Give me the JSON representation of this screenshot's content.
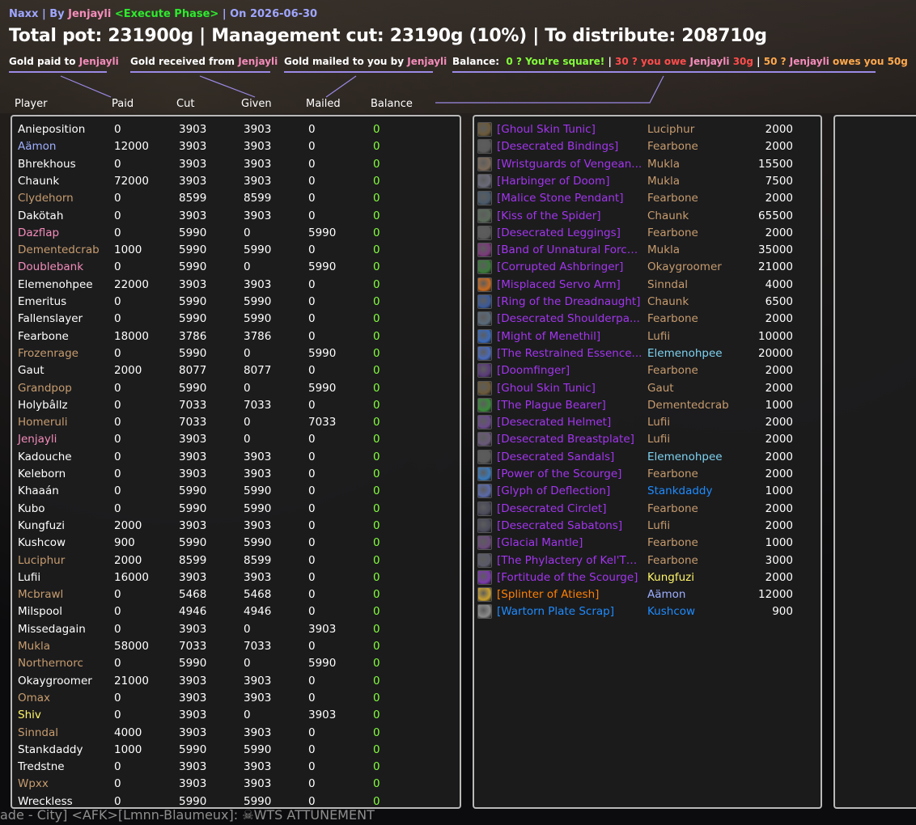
{
  "colors": {
    "title_text": "#ffffff",
    "accent": "#9b8ae6",
    "raid": "#9fa6ff",
    "player_jenjayli": "#f48cba",
    "phase": "#2eea2e",
    "balance_zero": "#83ff3c",
    "owe": "#ff4d4d",
    "owed": "#ffa94d",
    "epic": "#a335ee",
    "legendary": "#ff8000",
    "rare": "#1e8cff"
  },
  "header": {
    "raid": "Naxx",
    "by_sep": " | By ",
    "by_player": "Jenjayli",
    "phase": "<Execute Phase>",
    "date_sep": " | On ",
    "date": "2026-06-30"
  },
  "title": "Total pot: 231900g | Management cut: 23190g (10%) | To distribute: 208710g",
  "legend": {
    "paid_prefix": "Gold paid to ",
    "paid_player": "Jenjayli",
    "received_prefix": "Gold received from ",
    "received_player": "Jenjayli",
    "mailed_prefix": "Gold mailed to you by ",
    "mailed_player": "Jenjayli",
    "balance_label": "Balance:",
    "square_text": "0 ? You're square!",
    "sep": " | ",
    "owe_prefix": "30 ? you owe ",
    "owe_player": "Jenjayli",
    "owe_amount": " 30g",
    "owed_prefix": "50 ? ",
    "owed_player": "Jenjayli",
    "owed_suffix": " owes you 50g"
  },
  "columns": [
    "Player",
    "Paid",
    "Cut",
    "Given",
    "Mailed",
    "Balance"
  ],
  "players": [
    {
      "name": "Anieposition",
      "color": "#ffffff",
      "paid": "0",
      "cut": "3903",
      "given": "3903",
      "mailed": "0",
      "balance": "0"
    },
    {
      "name": "Aämon",
      "color": "#9fb0ff",
      "paid": "12000",
      "cut": "3903",
      "given": "3903",
      "mailed": "0",
      "balance": "0"
    },
    {
      "name": "Bhrekhous",
      "color": "#ffffff",
      "paid": "0",
      "cut": "3903",
      "given": "3903",
      "mailed": "0",
      "balance": "0"
    },
    {
      "name": "Chaunk",
      "color": "#ffffff",
      "paid": "72000",
      "cut": "3903",
      "given": "3903",
      "mailed": "0",
      "balance": "0"
    },
    {
      "name": "Clydehorn",
      "color": "#c79c6e",
      "paid": "0",
      "cut": "8599",
      "given": "8599",
      "mailed": "0",
      "balance": "0"
    },
    {
      "name": "Dakötah",
      "color": "#ffffff",
      "paid": "0",
      "cut": "3903",
      "given": "3903",
      "mailed": "0",
      "balance": "0"
    },
    {
      "name": "Dazflap",
      "color": "#f48cba",
      "paid": "0",
      "cut": "5990",
      "given": "0",
      "mailed": "5990",
      "balance": "0"
    },
    {
      "name": "Dementedcrab",
      "color": "#c79c6e",
      "paid": "1000",
      "cut": "5990",
      "given": "5990",
      "mailed": "0",
      "balance": "0"
    },
    {
      "name": "Doublebank",
      "color": "#f48cba",
      "paid": "0",
      "cut": "5990",
      "given": "0",
      "mailed": "5990",
      "balance": "0"
    },
    {
      "name": "Elemenohpee",
      "color": "#ffffff",
      "paid": "22000",
      "cut": "3903",
      "given": "3903",
      "mailed": "0",
      "balance": "0"
    },
    {
      "name": "Emeritus",
      "color": "#ffffff",
      "paid": "0",
      "cut": "5990",
      "given": "5990",
      "mailed": "0",
      "balance": "0"
    },
    {
      "name": "Fallenslayer",
      "color": "#ffffff",
      "paid": "0",
      "cut": "5990",
      "given": "5990",
      "mailed": "0",
      "balance": "0"
    },
    {
      "name": "Fearbone",
      "color": "#ffffff",
      "paid": "18000",
      "cut": "3786",
      "given": "3786",
      "mailed": "0",
      "balance": "0"
    },
    {
      "name": "Frozenrage",
      "color": "#c79c6e",
      "paid": "0",
      "cut": "5990",
      "given": "0",
      "mailed": "5990",
      "balance": "0"
    },
    {
      "name": "Gaut",
      "color": "#ffffff",
      "paid": "2000",
      "cut": "8077",
      "given": "8077",
      "mailed": "0",
      "balance": "0"
    },
    {
      "name": "Grandpop",
      "color": "#c79c6e",
      "paid": "0",
      "cut": "5990",
      "given": "0",
      "mailed": "5990",
      "balance": "0"
    },
    {
      "name": "Holybâllz",
      "color": "#ffffff",
      "paid": "0",
      "cut": "7033",
      "given": "7033",
      "mailed": "0",
      "balance": "0"
    },
    {
      "name": "Homeruli",
      "color": "#c79c6e",
      "paid": "0",
      "cut": "7033",
      "given": "0",
      "mailed": "7033",
      "balance": "0"
    },
    {
      "name": "Jenjayli",
      "color": "#f48cba",
      "paid": "0",
      "cut": "3903",
      "given": "0",
      "mailed": "0",
      "balance": "0"
    },
    {
      "name": "Kadouche",
      "color": "#ffffff",
      "paid": "0",
      "cut": "3903",
      "given": "3903",
      "mailed": "0",
      "balance": "0"
    },
    {
      "name": "Keleborn",
      "color": "#ffffff",
      "paid": "0",
      "cut": "3903",
      "given": "3903",
      "mailed": "0",
      "balance": "0"
    },
    {
      "name": "Khaaán",
      "color": "#ffffff",
      "paid": "0",
      "cut": "5990",
      "given": "5990",
      "mailed": "0",
      "balance": "0"
    },
    {
      "name": "Kubo",
      "color": "#ffffff",
      "paid": "0",
      "cut": "5990",
      "given": "5990",
      "mailed": "0",
      "balance": "0"
    },
    {
      "name": "Kungfuzi",
      "color": "#ffffff",
      "paid": "2000",
      "cut": "3903",
      "given": "3903",
      "mailed": "0",
      "balance": "0"
    },
    {
      "name": "Kushcow",
      "color": "#ffffff",
      "paid": "900",
      "cut": "5990",
      "given": "5990",
      "mailed": "0",
      "balance": "0"
    },
    {
      "name": "Luciphur",
      "color": "#c79c6e",
      "paid": "2000",
      "cut": "8599",
      "given": "8599",
      "mailed": "0",
      "balance": "0"
    },
    {
      "name": "Lufii",
      "color": "#ffffff",
      "paid": "16000",
      "cut": "3903",
      "given": "3903",
      "mailed": "0",
      "balance": "0"
    },
    {
      "name": "Mcbrawl",
      "color": "#c79c6e",
      "paid": "0",
      "cut": "5468",
      "given": "5468",
      "mailed": "0",
      "balance": "0"
    },
    {
      "name": "Milspool",
      "color": "#ffffff",
      "paid": "0",
      "cut": "4946",
      "given": "4946",
      "mailed": "0",
      "balance": "0"
    },
    {
      "name": "Missedagain",
      "color": "#ffffff",
      "paid": "0",
      "cut": "3903",
      "given": "0",
      "mailed": "3903",
      "balance": "0"
    },
    {
      "name": "Mukla",
      "color": "#c79c6e",
      "paid": "58000",
      "cut": "7033",
      "given": "7033",
      "mailed": "0",
      "balance": "0"
    },
    {
      "name": "Northernorc",
      "color": "#c79c6e",
      "paid": "0",
      "cut": "5990",
      "given": "0",
      "mailed": "5990",
      "balance": "0"
    },
    {
      "name": "Okaygroomer",
      "color": "#ffffff",
      "paid": "21000",
      "cut": "3903",
      "given": "3903",
      "mailed": "0",
      "balance": "0"
    },
    {
      "name": "Omax",
      "color": "#c79c6e",
      "paid": "0",
      "cut": "3903",
      "given": "3903",
      "mailed": "0",
      "balance": "0"
    },
    {
      "name": "Shiv",
      "color": "#fff569",
      "paid": "0",
      "cut": "3903",
      "given": "0",
      "mailed": "3903",
      "balance": "0"
    },
    {
      "name": "Sinndal",
      "color": "#c79c6e",
      "paid": "4000",
      "cut": "3903",
      "given": "3903",
      "mailed": "0",
      "balance": "0"
    },
    {
      "name": "Stankdaddy",
      "color": "#ffffff",
      "paid": "1000",
      "cut": "5990",
      "given": "5990",
      "mailed": "0",
      "balance": "0"
    },
    {
      "name": "Tredstne",
      "color": "#ffffff",
      "paid": "0",
      "cut": "3903",
      "given": "3903",
      "mailed": "0",
      "balance": "0"
    },
    {
      "name": "Wpxx",
      "color": "#c79c6e",
      "paid": "0",
      "cut": "3903",
      "given": "3903",
      "mailed": "0",
      "balance": "0"
    },
    {
      "name": "Wreckless",
      "color": "#ffffff",
      "paid": "0",
      "cut": "5990",
      "given": "5990",
      "mailed": "0",
      "balance": "0"
    }
  ],
  "items": [
    {
      "name": "[Ghoul Skin Tunic]",
      "quality": "#a335ee",
      "winner": "Luciphur",
      "winner_color": "#c79c6e",
      "price": "2000",
      "icon": "tunic-icon",
      "icon_color": "#6b5a3a"
    },
    {
      "name": "[Desecrated Bindings]",
      "quality": "#a335ee",
      "winner": "Fearbone",
      "winner_color": "#c79c6e",
      "price": "2000",
      "icon": "bracer-icon",
      "icon_color": "#5a5a5a"
    },
    {
      "name": "[Wristguards of Vengean...",
      "quality": "#a335ee",
      "winner": "Mukla",
      "winner_color": "#c79c6e",
      "price": "15500",
      "icon": "wrist-icon",
      "icon_color": "#7a6a5a"
    },
    {
      "name": "[Harbinger of Doom]",
      "quality": "#a335ee",
      "winner": "Mukla",
      "winner_color": "#c79c6e",
      "price": "7500",
      "icon": "dagger-icon",
      "icon_color": "#6a6a7a"
    },
    {
      "name": "[Malice Stone Pendant]",
      "quality": "#a335ee",
      "winner": "Fearbone",
      "winner_color": "#c79c6e",
      "price": "2000",
      "icon": "pendant-icon",
      "icon_color": "#4a5a6a"
    },
    {
      "name": "[Kiss of the Spider]",
      "quality": "#a335ee",
      "winner": "Chaunk",
      "winner_color": "#c79c6e",
      "price": "65500",
      "icon": "spider-icon",
      "icon_color": "#5a6a5a"
    },
    {
      "name": "[Desecrated Leggings]",
      "quality": "#a335ee",
      "winner": "Fearbone",
      "winner_color": "#c79c6e",
      "price": "2000",
      "icon": "leggings-icon",
      "icon_color": "#5a5a5a"
    },
    {
      "name": "[Band of Unnatural Forces]",
      "quality": "#a335ee",
      "winner": "Mukla",
      "winner_color": "#c79c6e",
      "price": "35000",
      "icon": "ring-icon",
      "icon_color": "#7a3a7a"
    },
    {
      "name": "[Corrupted Ashbringer]",
      "quality": "#a335ee",
      "winner": "Okaygroomer",
      "winner_color": "#c79c6e",
      "price": "21000",
      "icon": "sword-icon",
      "icon_color": "#3a7a3a"
    },
    {
      "name": "[Misplaced Servo Arm]",
      "quality": "#a335ee",
      "winner": "Sinndal",
      "winner_color": "#c79c6e",
      "price": "4000",
      "icon": "servo-arm-icon",
      "icon_color": "#c76a20"
    },
    {
      "name": "[Ring of the Dreadnaught]",
      "quality": "#a335ee",
      "winner": "Chaunk",
      "winner_color": "#c79c6e",
      "price": "6500",
      "icon": "ring-icon",
      "icon_color": "#3a5a9a"
    },
    {
      "name": "[Desecrated Shoulderpa...",
      "quality": "#a335ee",
      "winner": "Fearbone",
      "winner_color": "#c79c6e",
      "price": "2000",
      "icon": "shoulder-icon",
      "icon_color": "#5a6a7a"
    },
    {
      "name": "[Might of Menethil]",
      "quality": "#a335ee",
      "winner": "Lufii",
      "winner_color": "#c79c6e",
      "price": "10000",
      "icon": "mace-icon",
      "icon_color": "#3a6aba"
    },
    {
      "name": "[The Restrained Essence...",
      "quality": "#a335ee",
      "winner": "Elemenohpee",
      "winner_color": "#7fd3f0",
      "price": "20000",
      "icon": "essence-icon",
      "icon_color": "#4a6aba"
    },
    {
      "name": "[Doomfinger]",
      "quality": "#a335ee",
      "winner": "Fearbone",
      "winner_color": "#c79c6e",
      "price": "2000",
      "icon": "wand-icon",
      "icon_color": "#5a3a7a"
    },
    {
      "name": "[Ghoul Skin Tunic]",
      "quality": "#a335ee",
      "winner": "Gaut",
      "winner_color": "#c79c6e",
      "price": "2000",
      "icon": "tunic-icon",
      "icon_color": "#6b5a3a"
    },
    {
      "name": "[The Plague Bearer]",
      "quality": "#a335ee",
      "winner": "Dementedcrab",
      "winner_color": "#c79c6e",
      "price": "1000",
      "icon": "shield-icon",
      "icon_color": "#3a8a3a"
    },
    {
      "name": "[Desecrated Helmet]",
      "quality": "#a335ee",
      "winner": "Lufii",
      "winner_color": "#c79c6e",
      "price": "2000",
      "icon": "helmet-icon",
      "icon_color": "#6a4a8a"
    },
    {
      "name": "[Desecrated Breastplate]",
      "quality": "#a335ee",
      "winner": "Lufii",
      "winner_color": "#c79c6e",
      "price": "2000",
      "icon": "breastplate-icon",
      "icon_color": "#6a5a7a"
    },
    {
      "name": "[Desecrated Sandals]",
      "quality": "#a335ee",
      "winner": "Elemenohpee",
      "winner_color": "#7fd3f0",
      "price": "2000",
      "icon": "sandals-icon",
      "icon_color": "#5a5a5a"
    },
    {
      "name": "[Power of the Scourge]",
      "quality": "#a335ee",
      "winner": "Fearbone",
      "winner_color": "#c79c6e",
      "price": "2000",
      "icon": "scourge-icon",
      "icon_color": "#3a7aba"
    },
    {
      "name": "[Glyph of Deflection]",
      "quality": "#a335ee",
      "winner": "Stankdaddy",
      "winner_color": "#1e8cff",
      "price": "1000",
      "icon": "glyph-icon",
      "icon_color": "#5a6aaa"
    },
    {
      "name": "[Desecrated Circlet]",
      "quality": "#a335ee",
      "winner": "Fearbone",
      "winner_color": "#c79c6e",
      "price": "2000",
      "icon": "circlet-icon",
      "icon_color": "#4a4a5a"
    },
    {
      "name": "[Desecrated Sabatons]",
      "quality": "#a335ee",
      "winner": "Lufii",
      "winner_color": "#c79c6e",
      "price": "2000",
      "icon": "sabatons-icon",
      "icon_color": "#4a4a5a"
    },
    {
      "name": "[Glacial Mantle]",
      "quality": "#a335ee",
      "winner": "Fearbone",
      "winner_color": "#c79c6e",
      "price": "1000",
      "icon": "mantle-icon",
      "icon_color": "#6a4a7a"
    },
    {
      "name": "[The Phylactery of Kel'Th...",
      "quality": "#a335ee",
      "winner": "Fearbone",
      "winner_color": "#c79c6e",
      "price": "3000",
      "icon": "phylactery-icon",
      "icon_color": "#5a5a6a"
    },
    {
      "name": "[Fortitude of the Scourge]",
      "quality": "#a335ee",
      "winner": "Kungfuzi",
      "winner_color": "#fff569",
      "price": "2000",
      "icon": "scourge-icon",
      "icon_color": "#7a3aaa"
    },
    {
      "name": "[Splinter of Atiesh]",
      "quality": "#ff8000",
      "winner": "Aämon",
      "winner_color": "#9fb0ff",
      "price": "12000",
      "icon": "splinter-icon",
      "icon_color": "#c8a030"
    },
    {
      "name": "[Wartorn Plate Scrap]",
      "quality": "#1e8cff",
      "winner": "Kushcow",
      "winner_color": "#1e8cff",
      "price": "900",
      "icon": "scrap-icon",
      "icon_color": "#8a8a8a"
    }
  ],
  "chat_fragment": "ade - City] <AFK>[Lmnn-Blaumeux]: ☠WTS ATTUNEMENT"
}
